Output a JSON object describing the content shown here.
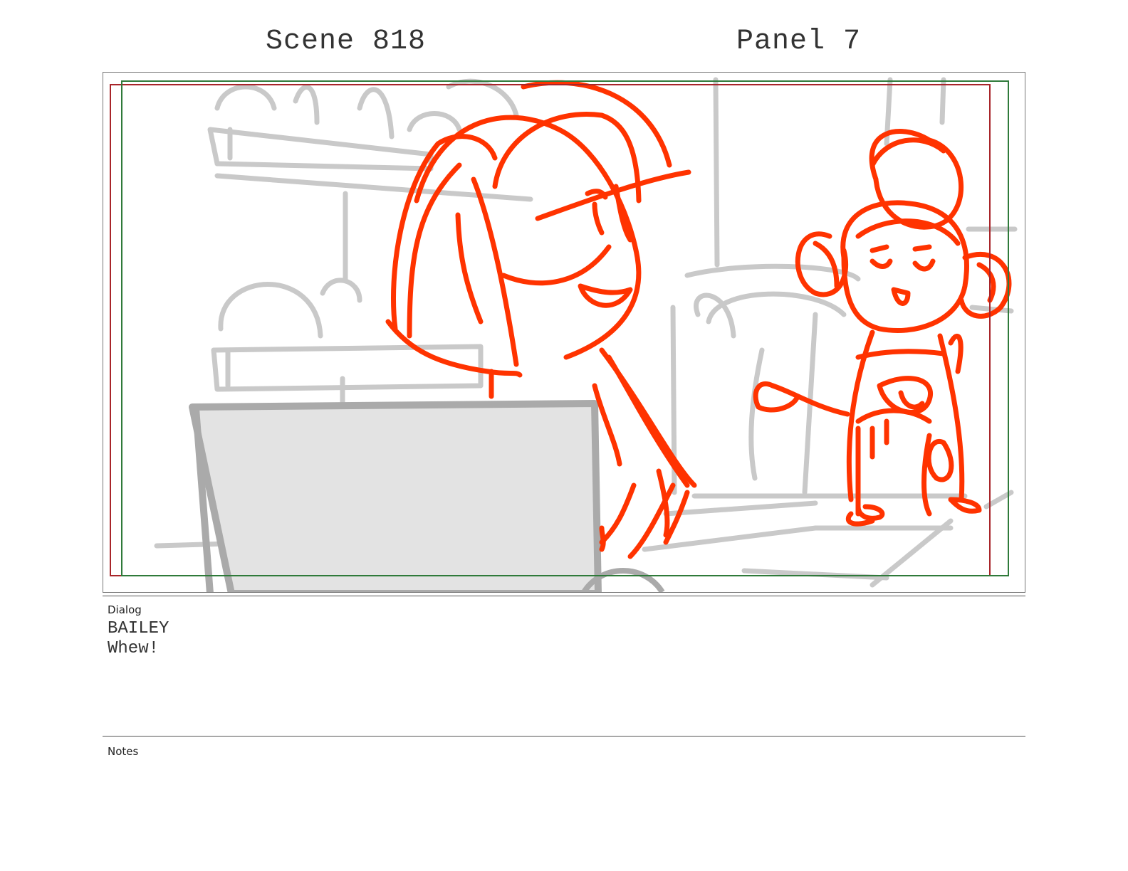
{
  "header": {
    "scene": "Scene 818",
    "panel": "Panel 7"
  },
  "dialog": {
    "label": "Dialog",
    "character": "BAILEY",
    "line": "Whew!"
  },
  "notes": {
    "label": "Notes"
  },
  "colors": {
    "sketch_red": "#ff3300",
    "sketch_gray": "#c8c8c8",
    "safe_area_red": "#a8252a",
    "safe_area_green": "#2f7a3a"
  }
}
